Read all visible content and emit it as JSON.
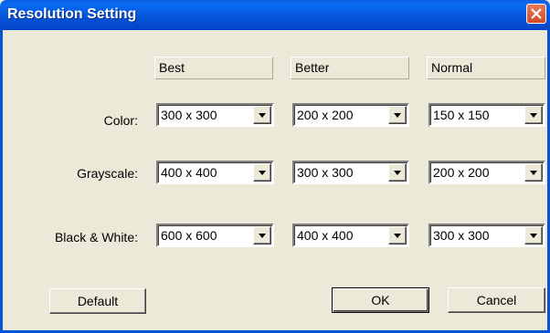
{
  "window": {
    "title": "Resolution Setting"
  },
  "columns": [
    "Best",
    "Better",
    "Normal"
  ],
  "rows": [
    {
      "label": "Color:",
      "values": [
        "300 x 300",
        "200 x 200",
        "150 x 150"
      ]
    },
    {
      "label": "Grayscale:",
      "values": [
        "400 x 400",
        "300 x 300",
        "200 x 200"
      ]
    },
    {
      "label": "Black & White:",
      "values": [
        "600 x 600",
        "400 x 400",
        "300 x 300"
      ]
    }
  ],
  "buttons": {
    "default": "Default",
    "ok": "OK",
    "cancel": "Cancel"
  }
}
